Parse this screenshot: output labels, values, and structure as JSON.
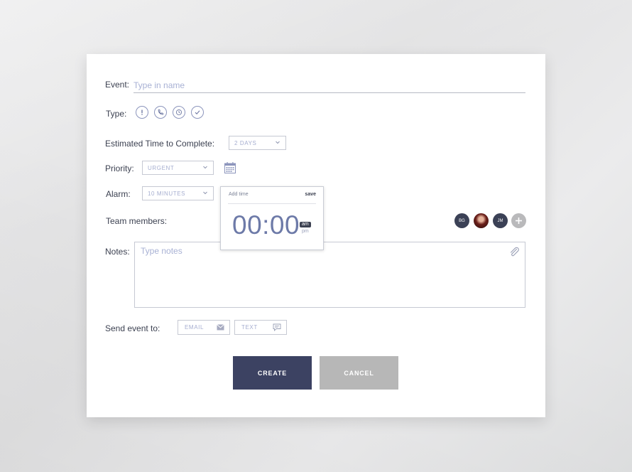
{
  "form": {
    "event_label": "Event:",
    "event_placeholder": "Type in name",
    "type_label": "Type:",
    "type_icons": [
      "exclamation-icon",
      "phone-icon",
      "clock-icon",
      "check-icon"
    ],
    "estimated_label": "Estimated Time to Complete:",
    "estimated_value": "2 DAYS",
    "priority_label": "Priority:",
    "priority_value": "URGENT",
    "alarm_label": "Alarm:",
    "alarm_value": "10 MINUTES",
    "team_label": "Team members:",
    "notes_label": "Notes:",
    "notes_placeholder": "Type notes",
    "send_label": "Send event to:",
    "email_label": "EMAIL",
    "text_label": "TEXT"
  },
  "time_popup": {
    "title": "Add time",
    "save": "save",
    "time": "00:00",
    "am": "am",
    "pm": "pm"
  },
  "team": {
    "members": [
      {
        "initials": "BG",
        "color": "#3b4156"
      },
      {
        "initials": "",
        "color": "#7a3b2c",
        "photo": true
      },
      {
        "initials": "JM",
        "color": "#3b4156"
      }
    ],
    "add_icon": "plus-icon"
  },
  "buttons": {
    "create": "CREATE",
    "cancel": "CANCEL"
  },
  "colors": {
    "accent": "#3c4262",
    "create_bg": "#3c4262",
    "cancel_bg": "#b7b7b7",
    "placeholder": "#a8b1d4"
  }
}
